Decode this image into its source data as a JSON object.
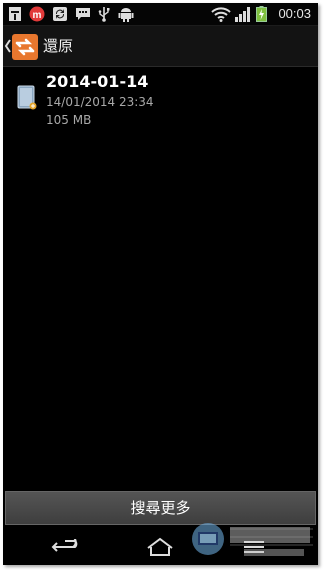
{
  "status_bar": {
    "time": "00:03",
    "icons": [
      "sim-icon",
      "m-app-icon",
      "sync-icon",
      "chat-icon",
      "usb-icon",
      "android-debug-icon",
      "wifi-icon",
      "signal-icon",
      "battery-charging-icon"
    ]
  },
  "action_bar": {
    "title": "還原",
    "icons": [
      "back-chevron-icon",
      "app-logo-icon"
    ]
  },
  "backup_list": [
    {
      "title": "2014-01-14",
      "datetime": "14/01/2014 23:34",
      "size": "105 MB",
      "icon": "sd-card-file-icon"
    }
  ],
  "search_more_label": "搜尋更多",
  "nav_bar": {
    "icons": [
      "back-icon",
      "home-icon",
      "menu-icon"
    ]
  },
  "colors": {
    "background": "#000000",
    "app_icon_orange": "#e8772e",
    "button_gray": "#4a4a4a"
  }
}
